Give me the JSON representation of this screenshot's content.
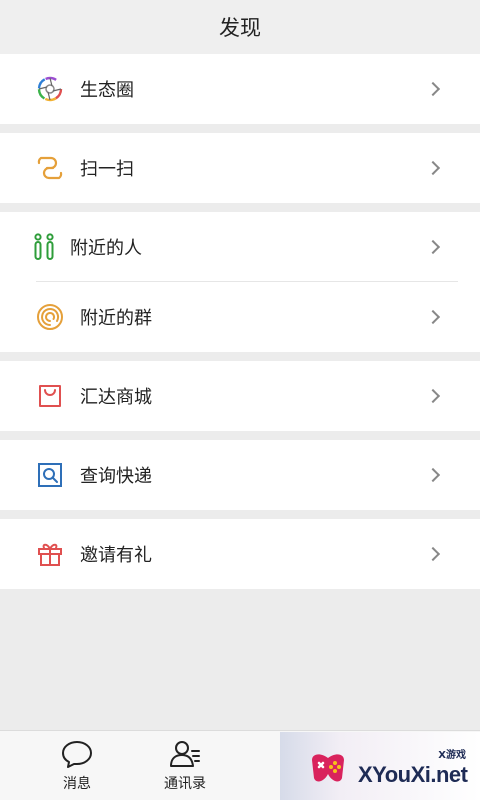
{
  "header": {
    "title": "发现"
  },
  "menu": {
    "groups": [
      {
        "items": [
          {
            "label": "生态圈",
            "icon": "ecosystem-icon"
          }
        ]
      },
      {
        "items": [
          {
            "label": "扫一扫",
            "icon": "scan-icon"
          }
        ]
      },
      {
        "items": [
          {
            "label": "附近的人",
            "icon": "nearby-people-icon"
          },
          {
            "label": "附近的群",
            "icon": "nearby-groups-icon"
          }
        ]
      },
      {
        "items": [
          {
            "label": "汇达商城",
            "icon": "mall-bag-icon"
          }
        ]
      },
      {
        "items": [
          {
            "label": "查询快递",
            "icon": "express-search-icon"
          }
        ]
      },
      {
        "items": [
          {
            "label": "邀请有礼",
            "icon": "gift-icon"
          }
        ]
      }
    ]
  },
  "tabbar": {
    "tabs": [
      {
        "label": "消息",
        "icon": "chat-bubble-icon"
      },
      {
        "label": "通讯录",
        "icon": "contacts-icon"
      }
    ]
  },
  "watermark": {
    "brand": "XYouXi.net",
    "brand_cn": "X游戏"
  },
  "colors": {
    "green": "#2e9d3a",
    "orange": "#e5a03a",
    "red": "#e05050",
    "blue": "#2e6fb8"
  }
}
